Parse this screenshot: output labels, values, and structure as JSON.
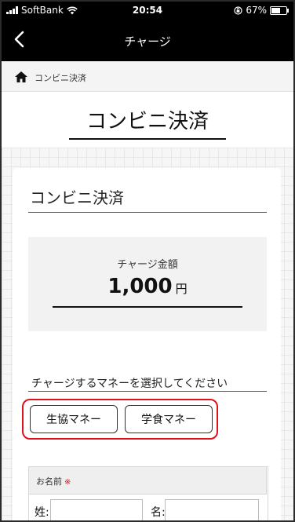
{
  "status_bar": {
    "carrier": "SoftBank",
    "time": "20:54",
    "battery_percent": "67%",
    "battery_level": 0.67,
    "icons": [
      "signal-icon",
      "wifi-icon",
      "rotation-lock-icon",
      "battery-icon"
    ]
  },
  "nav": {
    "title": "チャージ",
    "back_icon": "chevron-left-icon"
  },
  "breadcrumb": {
    "home_icon": "home-icon",
    "current": "コンビニ決済"
  },
  "page": {
    "title": "コンビニ決済"
  },
  "card": {
    "title": "コンビニ決済",
    "amount_label": "チャージ金額",
    "amount_value": "1,000",
    "amount_unit": "円",
    "select_prompt": "チャージするマネーを選択してください",
    "money_options": [
      {
        "label": "生協マネー"
      },
      {
        "label": "学食マネー"
      }
    ],
    "highlight_color": "#e0101c"
  },
  "form": {
    "name_label": "お名前",
    "required_mark": "※",
    "last_name_label": "姓:",
    "first_name_label": "名:",
    "last_name_value": "",
    "first_name_value": ""
  }
}
